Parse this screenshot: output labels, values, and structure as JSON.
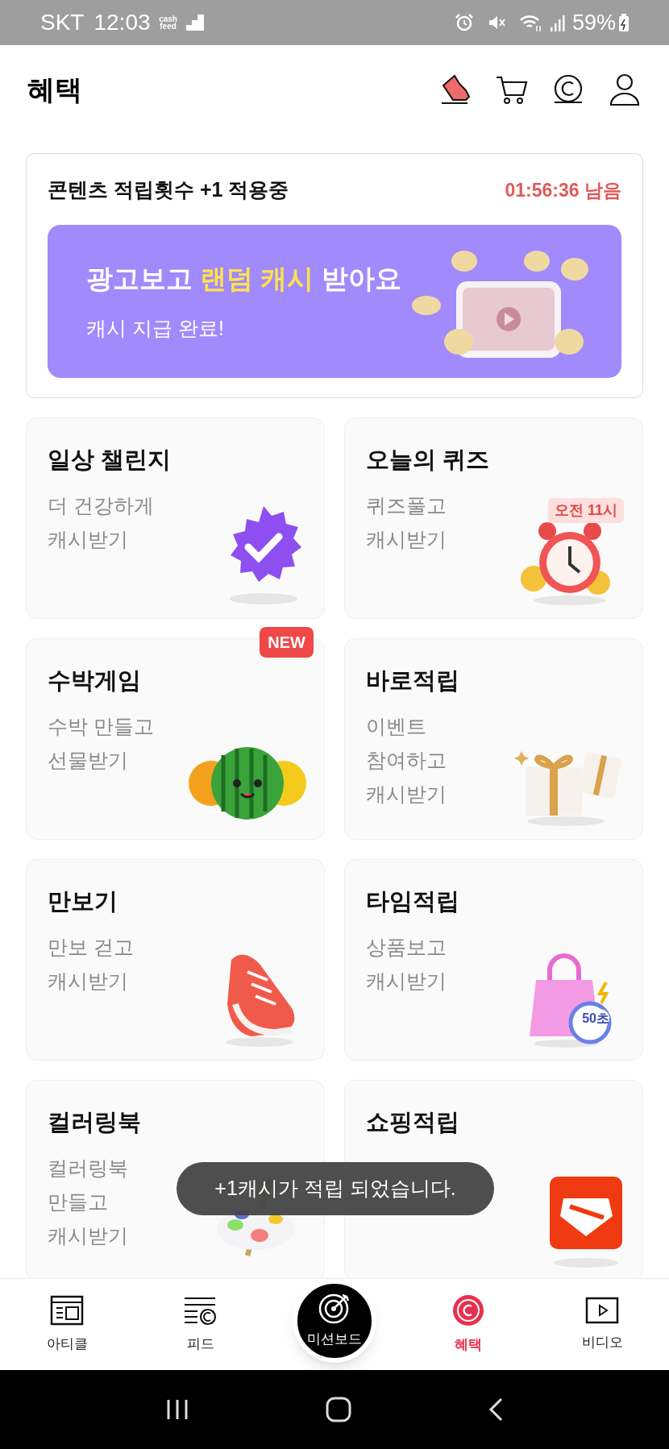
{
  "status_bar": {
    "carrier": "SKT",
    "time": "12:03",
    "app_badge": "cash feed",
    "battery": "59%"
  },
  "header": {
    "title": "혜택"
  },
  "boost": {
    "label": "콘텐츠 적립횟수 +1 적용중",
    "remaining": "01:56:36 남음",
    "banner": {
      "title_parts": [
        {
          "text": "광고보고 ",
          "highlight": false
        },
        {
          "text": "랜덤 캐시",
          "highlight": true
        },
        {
          "text": " 받아요",
          "highlight": false
        }
      ],
      "subtitle": "캐시 지급 완료!"
    }
  },
  "tiles": [
    {
      "title": "일상 챌린지",
      "lines": [
        "더 건강하게",
        "캐시받기"
      ],
      "kind": "badge"
    },
    {
      "title": "오늘의 퀴즈",
      "lines": [
        "퀴즈풀고",
        "캐시받기"
      ],
      "kind": "clock",
      "tag": "오전 11시"
    },
    {
      "title": "수박게임",
      "lines": [
        "수박 만들고",
        "선물받기"
      ],
      "kind": "watermelon",
      "new_label": "NEW"
    },
    {
      "title": "바로적립",
      "lines": [
        "이벤트",
        "참여하고",
        "캐시받기"
      ],
      "kind": "gift"
    },
    {
      "title": "만보기",
      "lines": [
        "만보 걷고",
        "캐시받기"
      ],
      "kind": "shoe"
    },
    {
      "title": "타임적립",
      "lines": [
        "상품보고",
        "캐시받기"
      ],
      "kind": "bag",
      "tag": "50초"
    },
    {
      "title": "컬러링북",
      "lines": [
        "컬러링북",
        "만들고",
        "캐시받기"
      ],
      "kind": "palette"
    },
    {
      "title": "쇼핑적립",
      "kind": "shop"
    }
  ],
  "toast": "+1캐시가 적립 되었습니다.",
  "nav": [
    {
      "label": "아티클",
      "kind": "article",
      "selected": false
    },
    {
      "label": "피드",
      "kind": "feed",
      "selected": false
    },
    {
      "label": "미션보드",
      "kind": "mission",
      "selected": false
    },
    {
      "label": "혜택",
      "kind": "benefit",
      "selected": true
    },
    {
      "label": "비디오",
      "kind": "video",
      "selected": false
    }
  ]
}
